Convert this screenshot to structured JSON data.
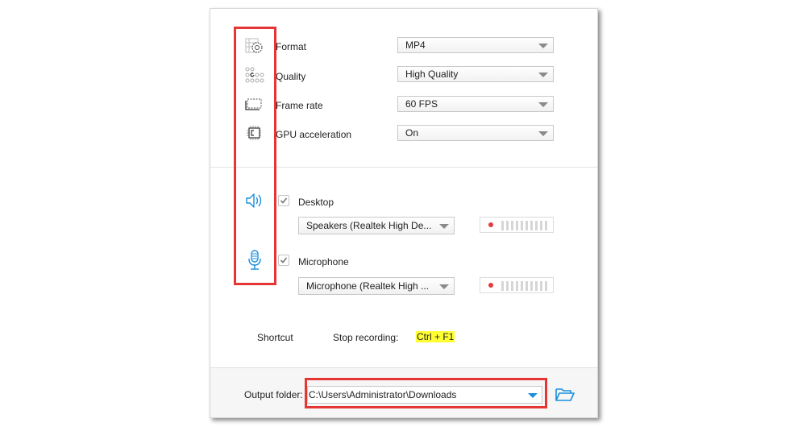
{
  "video": {
    "rows": [
      {
        "icon": "format-settings-icon",
        "label": "Format",
        "value": "MP4"
      },
      {
        "icon": "quality-dots-icon",
        "label": "Quality",
        "value": "High Quality"
      },
      {
        "icon": "frame-rate-icon",
        "label": "Frame rate",
        "value": "60 FPS"
      },
      {
        "icon": "gpu-chip-icon",
        "label": "GPU acceleration",
        "value": "On"
      }
    ]
  },
  "audio": {
    "desktop": {
      "icon": "speaker-icon",
      "label": "Desktop",
      "checked": true,
      "device": "Speakers (Realtek High De...",
      "level": 0
    },
    "microphone": {
      "icon": "microphone-icon",
      "label": "Microphone",
      "checked": true,
      "device": "Microphone (Realtek High ...",
      "level": 0
    }
  },
  "shortcut": {
    "label": "Shortcut",
    "action": "Stop recording:",
    "keys": "Ctrl + F1"
  },
  "output": {
    "label": "Output folder:",
    "path": "C:\\Users\\Administrator\\Downloads",
    "browse_icon": "folder-open-icon"
  },
  "colors": {
    "accent": "#1a8fde",
    "highlight_box": "#e53535",
    "shortcut_highlight": "#ffff33",
    "record_dot": "#e23b3b"
  }
}
